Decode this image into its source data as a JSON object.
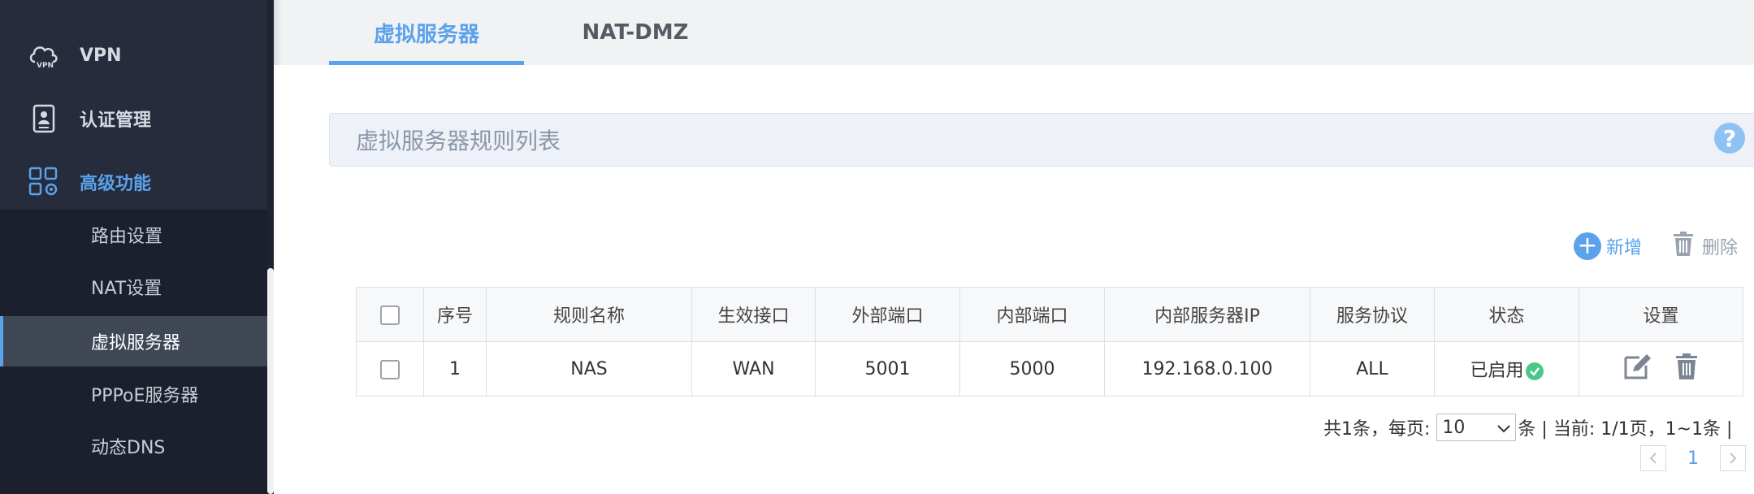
{
  "sidebar": {
    "items": [
      {
        "label": "VPN",
        "icon": "vpn-cloud-icon"
      },
      {
        "label": "认证管理",
        "icon": "id-badge-icon"
      },
      {
        "label": "高级功能",
        "icon": "apps-gear-icon",
        "active": true
      }
    ],
    "submenu": [
      {
        "label": "路由设置"
      },
      {
        "label": "NAT设置"
      },
      {
        "label": "虚拟服务器",
        "active": true
      },
      {
        "label": "PPPoE服务器"
      },
      {
        "label": "动态DNS"
      }
    ]
  },
  "tabs": [
    {
      "label": "虚拟服务器",
      "active": true
    },
    {
      "label": "NAT-DMZ"
    }
  ],
  "panel": {
    "title": "虚拟服务器规则列表",
    "help": "?"
  },
  "toolbar": {
    "add_label": "新增",
    "delete_label": "删除"
  },
  "table": {
    "headers": [
      "序号",
      "规则名称",
      "生效接口",
      "外部端口",
      "内部端口",
      "内部服务器IP",
      "服务协议",
      "状态",
      "设置"
    ],
    "rows": [
      {
        "index": "1",
        "name": "NAS",
        "interface": "WAN",
        "ext_port": "5001",
        "int_port": "5000",
        "server_ip": "192.168.0.100",
        "protocol": "ALL",
        "status": "已启用"
      }
    ]
  },
  "pagination": {
    "prefix": "共1条，每页:",
    "page_size": "10",
    "suffix": "条 | 当前: 1/1页，1~1条 |",
    "current_page": "1"
  },
  "colors": {
    "accent": "#5aa2ec",
    "sidebar_bg": "#262c3b",
    "status_ok": "#4cc78a"
  }
}
